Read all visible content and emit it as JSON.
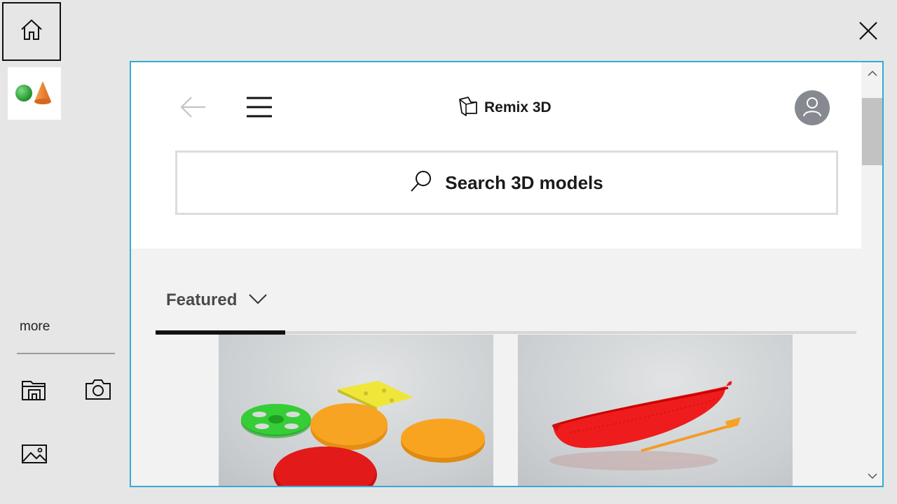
{
  "left_rail": {
    "home_icon": "home-icon",
    "shapes_icon": "3d-shapes-icon",
    "more_label": "more",
    "tools": [
      {
        "name": "3d-library-icon"
      },
      {
        "name": "camera-icon"
      },
      {
        "name": "image-icon"
      }
    ]
  },
  "window": {
    "close_icon": "close-icon"
  },
  "panel": {
    "header": {
      "back_icon": "back-arrow-icon",
      "menu_icon": "hamburger-menu-icon",
      "brand_icon": "remix-3d-logo-icon",
      "brand_title": "Remix 3D",
      "account_icon": "user-account-icon"
    },
    "search": {
      "icon": "search-icon",
      "placeholder": "Search 3D models"
    },
    "tabs": {
      "featured_label": "Featured",
      "chevron": "chevron-down-icon"
    },
    "models": [
      {
        "name": "3d-model-card-shapes"
      },
      {
        "name": "3d-model-card-boat"
      }
    ]
  },
  "colors": {
    "panel_border": "#35a9d8",
    "avatar_bg": "#868a90"
  }
}
